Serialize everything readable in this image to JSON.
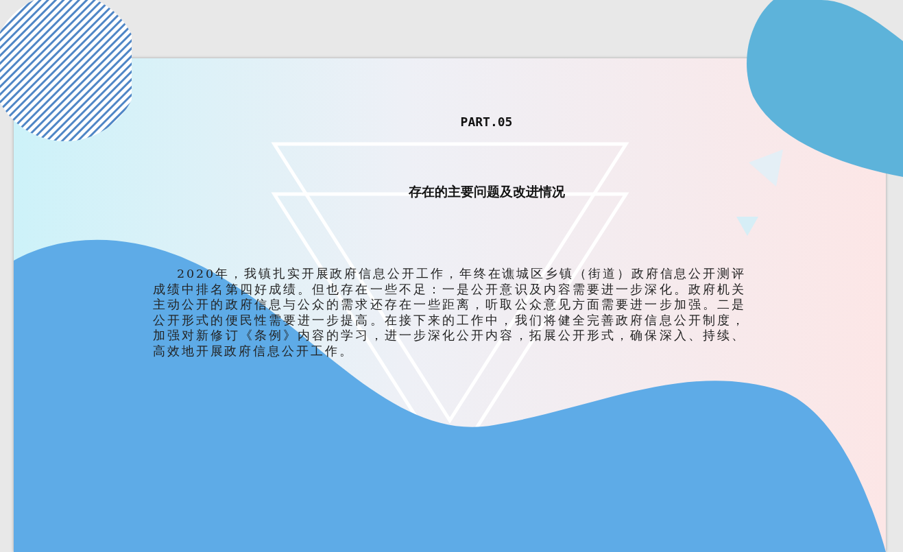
{
  "slide": {
    "part_label": "PART.05",
    "title": "存在的主要问题及改进情况",
    "body": "2020年，我镇扎实开展政府信息公开工作，年终在谯城区乡镇（街道）政府信息公开测评成绩中排名第四好成绩。但也存在一些不足：一是公开意识及内容需要进一步深化。政府机关主动公开的政府信息与公众的需求还存在一些距离，听取公众意见方面需要进一步加强。二是公开形式的便民性需要进一步提高。在接下来的工作中，我们将健全完善政府信息公开制度，加强对新修订《条例》内容的学习，进一步深化公开内容，拓展公开形式，确保深入、持续、高效地开展政府信息公开工作。"
  }
}
